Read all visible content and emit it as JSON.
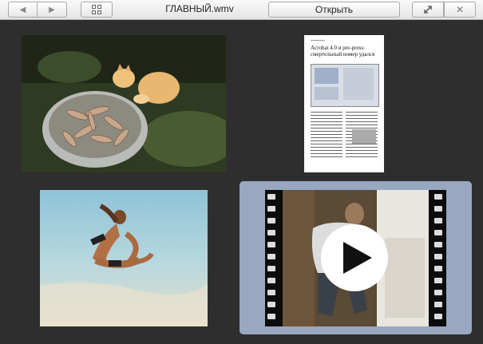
{
  "toolbar": {
    "title": "ГЛАВНЫЙ.wmv",
    "open_label": "Открыть",
    "back_icon": "◀",
    "forward_icon": "▶",
    "pin_icon": "↗",
    "close_icon": "✕"
  },
  "document_thumb": {
    "title": "Acrobat 4.0 и pre-press: смертельный номер удался"
  },
  "colors": {
    "background": "#2e2e2e",
    "selection": "#97a8c0"
  }
}
